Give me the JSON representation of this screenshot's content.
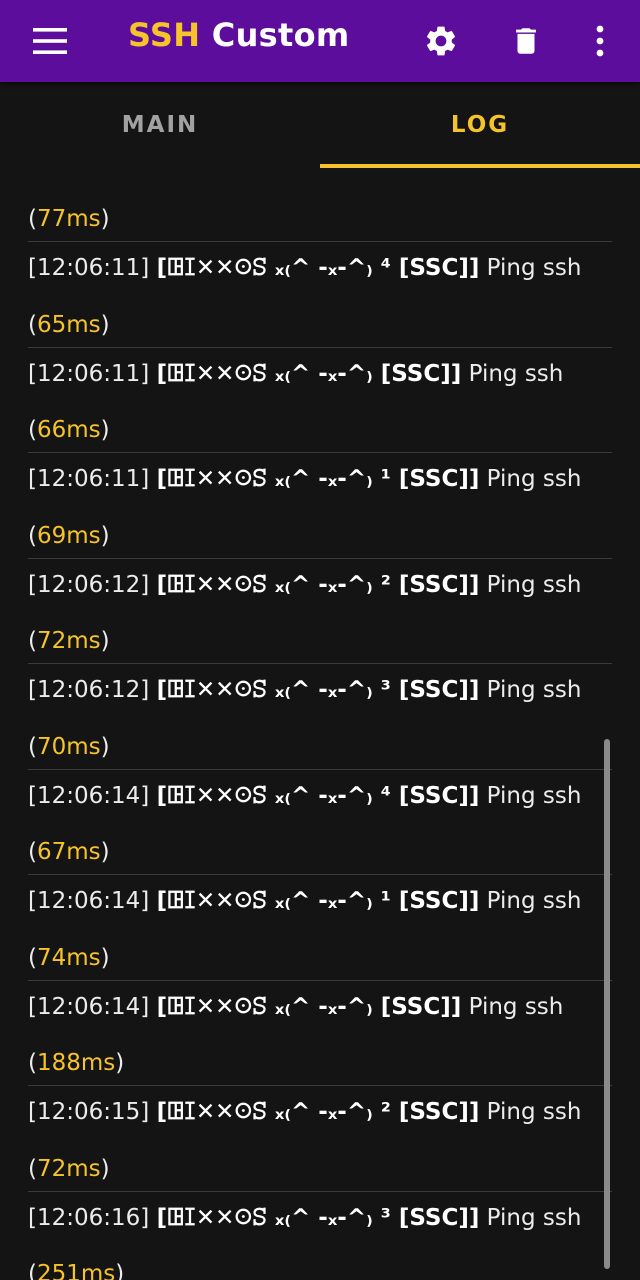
{
  "appbar": {
    "title_highlight": "SSH",
    "title_rest": " Custom",
    "menu_icon": "menu-icon",
    "actions": [
      "settings-icon",
      "delete-icon",
      "more-vert-icon"
    ],
    "brand_color": "#5c0d9c",
    "accent_color": "#f6c32a"
  },
  "tabs": [
    {
      "label": "MAIN",
      "selected": false
    },
    {
      "label": "LOG",
      "selected": true
    }
  ],
  "log": {
    "first_ms": "77ms",
    "entries": [
      {
        "time": "[12:06:11]",
        "tag": "[ꖸꕯ✕✕ꖴꕶ ₓ₍^ ‑ₓ‑^₎ ⁴ [SSC]]",
        "message": "Ping ssh",
        "ms": "65ms"
      },
      {
        "time": "[12:06:11]",
        "tag": "[ꖸꕯ✕✕ꖴꕶ ₓ₍^ ‑ₓ‑^₎ [SSC]]",
        "message": "Ping ssh",
        "ms": "66ms"
      },
      {
        "time": "[12:06:11]",
        "tag": "[ꖸꕯ✕✕ꖴꕶ ₓ₍^ ‑ₓ‑^₎ ¹ [SSC]]",
        "message": "Ping ssh",
        "ms": "69ms"
      },
      {
        "time": "[12:06:12]",
        "tag": "[ꖸꕯ✕✕ꖴꕶ ₓ₍^ ‑ₓ‑^₎ ² [SSC]]",
        "message": "Ping ssh",
        "ms": "72ms"
      },
      {
        "time": "[12:06:12]",
        "tag": "[ꖸꕯ✕✕ꖴꕶ ₓ₍^ ‑ₓ‑^₎ ³ [SSC]]",
        "message": "Ping ssh",
        "ms": "70ms"
      },
      {
        "time": "[12:06:14]",
        "tag": "[ꖸꕯ✕✕ꖴꕶ ₓ₍^ ‑ₓ‑^₎ ⁴ [SSC]]",
        "message": "Ping ssh",
        "ms": "67ms"
      },
      {
        "time": "[12:06:14]",
        "tag": "[ꖸꕯ✕✕ꖴꕶ ₓ₍^ ‑ₓ‑^₎ ¹ [SSC]]",
        "message": "Ping ssh",
        "ms": "74ms"
      },
      {
        "time": "[12:06:14]",
        "tag": "[ꖸꕯ✕✕ꖴꕶ ₓ₍^ ‑ₓ‑^₎ [SSC]]",
        "message": "Ping ssh",
        "ms": "188ms"
      },
      {
        "time": "[12:06:15]",
        "tag": "[ꖸꕯ✕✕ꖴꕶ ₓ₍^ ‑ₓ‑^₎ ² [SSC]]",
        "message": "Ping ssh",
        "ms": "72ms"
      },
      {
        "time": "[12:06:16]",
        "tag": "[ꖸꕯ✕✕ꖴꕶ ₓ₍^ ‑ₓ‑^₎ ³ [SSC]]",
        "message": "Ping ssh",
        "ms": "251ms"
      }
    ]
  }
}
